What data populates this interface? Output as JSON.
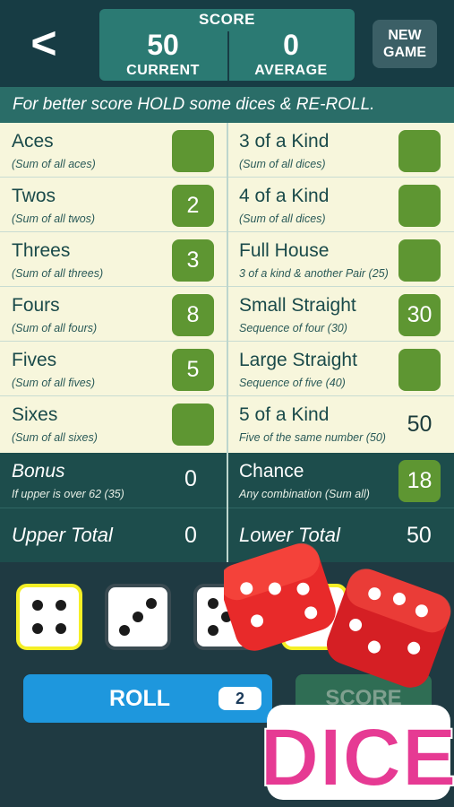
{
  "header": {
    "back_label": "<",
    "score_title": "SCORE",
    "current_value": "50",
    "current_label": "CURRENT",
    "average_value": "0",
    "average_label": "AVERAGE",
    "new_game_line1": "NEW",
    "new_game_line2": "GAME"
  },
  "banner": "For better score HOLD some dices & RE-ROLL.",
  "upper": [
    {
      "name": "Aces",
      "sub": "(Sum of all aces)",
      "value": ""
    },
    {
      "name": "Twos",
      "sub": "(Sum of all twos)",
      "value": "2"
    },
    {
      "name": "Threes",
      "sub": "(Sum of all threes)",
      "value": "3"
    },
    {
      "name": "Fours",
      "sub": "(Sum of all fours)",
      "value": "8"
    },
    {
      "name": "Fives",
      "sub": "(Sum of all fives)",
      "value": "5"
    },
    {
      "name": "Sixes",
      "sub": "(Sum of all sixes)",
      "value": ""
    }
  ],
  "lower": [
    {
      "name": "3 of a Kind",
      "sub": "(Sum of all dices)",
      "value": ""
    },
    {
      "name": "4 of a Kind",
      "sub": "(Sum of all dices)",
      "value": ""
    },
    {
      "name": "Full House",
      "sub": "3 of a kind & another Pair (25)",
      "value": ""
    },
    {
      "name": "Small Straight",
      "sub": "Sequence of four (30)",
      "value": "30"
    },
    {
      "name": "Large Straight",
      "sub": "Sequence of five (40)",
      "value": ""
    },
    {
      "name": "5 of a Kind",
      "sub": "Five of the same number (50)",
      "value": "50"
    }
  ],
  "bonus": {
    "name": "Bonus",
    "sub": "If upper is over 62 (35)",
    "value": "0"
  },
  "chance": {
    "name": "Chance",
    "sub": "Any combination (Sum all)",
    "value": "18"
  },
  "upper_total": {
    "label": "Upper Total",
    "value": "0"
  },
  "lower_total": {
    "label": "Lower Total",
    "value": "50"
  },
  "dice": [
    {
      "face": 4,
      "held": true
    },
    {
      "face": 3,
      "held": false
    },
    {
      "face": 5,
      "held": false
    },
    {
      "face": 2,
      "held": true
    }
  ],
  "controls": {
    "roll_label": "ROLL",
    "rolls_left": "2",
    "score_label": "SCORE"
  },
  "logo": {
    "text": "DICE"
  },
  "colors": {
    "accent": "#5e9632",
    "roll": "#1e97dd",
    "held": "#f4ef26",
    "logo_pink": "#e63a93",
    "die_red": "#e82a2a"
  }
}
